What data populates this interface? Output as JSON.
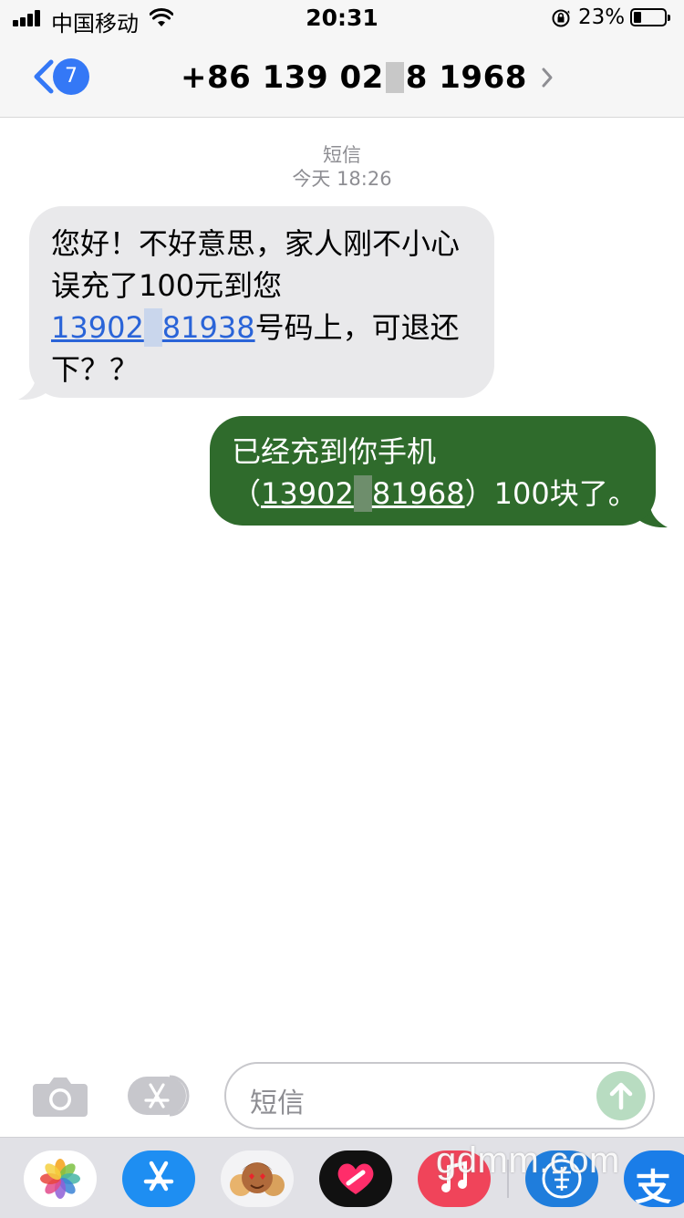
{
  "status_bar": {
    "carrier": "中国移动",
    "time": "20:31",
    "battery": "23%",
    "battery_level": 0.23
  },
  "nav": {
    "back_badge": "7",
    "contact_number": "+86 139 02",
    "contact_number_end": "8 1968"
  },
  "thread": {
    "service": "短信",
    "timestamp": "今天 18:26"
  },
  "messages": {
    "incoming": {
      "text_before": "您好！不好意思，家人刚不小心误充了100元到您",
      "link_start": "13902",
      "link_end": "81938",
      "text_after": "号码上，可退还下？？"
    },
    "outgoing": {
      "line1": "已经充到你手机",
      "open_paren": "（",
      "link_start": "13902",
      "link_end": "81968",
      "text_after": "）100块了。"
    }
  },
  "composer": {
    "placeholder": "短信"
  },
  "tray": {
    "apps": [
      "photos-app",
      "app-store-app",
      "memoji-app",
      "digital-touch-app",
      "music-app",
      "extension-app",
      "alipay-app"
    ],
    "alipay_glyph": "支"
  },
  "watermark": "gdmm.com",
  "colors": {
    "accent": "#3478f6",
    "incoming_bubble": "#e9e9eb",
    "outgoing_bubble": "#2f6b2c",
    "link": "#2a64d8"
  }
}
